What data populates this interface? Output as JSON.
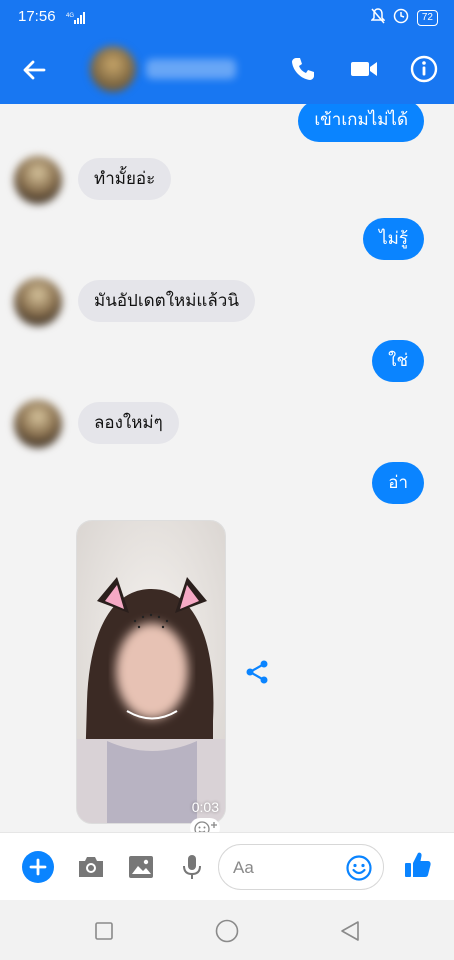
{
  "status_bar": {
    "time": "17:56",
    "network": "4G",
    "battery": "72"
  },
  "header": {
    "contact_name": "",
    "icons": [
      "back-arrow-icon",
      "phone-icon",
      "video-camera-icon",
      "info-icon"
    ]
  },
  "messages": [
    {
      "from": "me",
      "text": "เข้าเกมไม่ได้"
    },
    {
      "from": "them",
      "text": "ทำมั้ยอ่ะ"
    },
    {
      "from": "me",
      "text": "ไม่รู้"
    },
    {
      "from": "them",
      "text": "มันอัปเดตใหม่แล้วนิ"
    },
    {
      "from": "me",
      "text": "ใช่"
    },
    {
      "from": "them",
      "text": "ลองใหม่ๆ"
    },
    {
      "from": "me",
      "text": "อ่า"
    }
  ],
  "video": {
    "duration": "0:03"
  },
  "composer": {
    "placeholder": "Aa",
    "icons": [
      "plus-icon",
      "camera-icon",
      "image-icon",
      "microphone-icon",
      "emoji-icon",
      "thumbs-up-icon"
    ]
  },
  "navigation": {
    "icons": [
      "recent-apps-icon",
      "home-icon",
      "back-icon"
    ]
  },
  "colors": {
    "header": "#1877f2",
    "outgoing_bubble": "#0a84ff",
    "incoming_bubble": "#e5e5ea"
  }
}
